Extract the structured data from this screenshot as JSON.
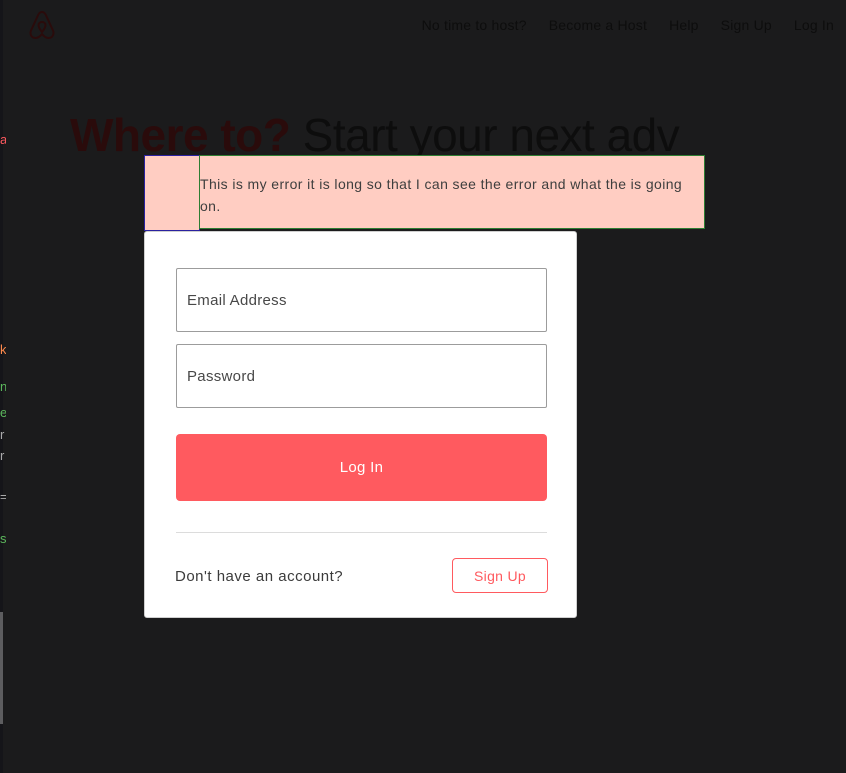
{
  "header": {
    "logo_icon": "airbnb-logo-icon",
    "nav": [
      {
        "label": "No time to host?"
      },
      {
        "label": "Become a Host"
      },
      {
        "label": "Help"
      },
      {
        "label": "Sign Up"
      },
      {
        "label": "Log In"
      }
    ]
  },
  "hero": {
    "bold_text": "Where to?",
    "rest_text": " Start your next adv"
  },
  "error": {
    "message": "This is my error it is long so that I can see the error and what the is going on."
  },
  "login_modal": {
    "email_placeholder": "Email Address",
    "password_placeholder": "Password",
    "login_label": "Log In",
    "no_account_text": "Don't have an account?",
    "signup_label": "Sign Up"
  },
  "left_edge_chars": [
    "a",
    "k",
    "n",
    "e",
    "r",
    "r",
    "=",
    "s"
  ],
  "colors": {
    "brand": "#ff5a5f",
    "error_background": "#ffcdc2",
    "page_background": "#1b1b1c"
  }
}
